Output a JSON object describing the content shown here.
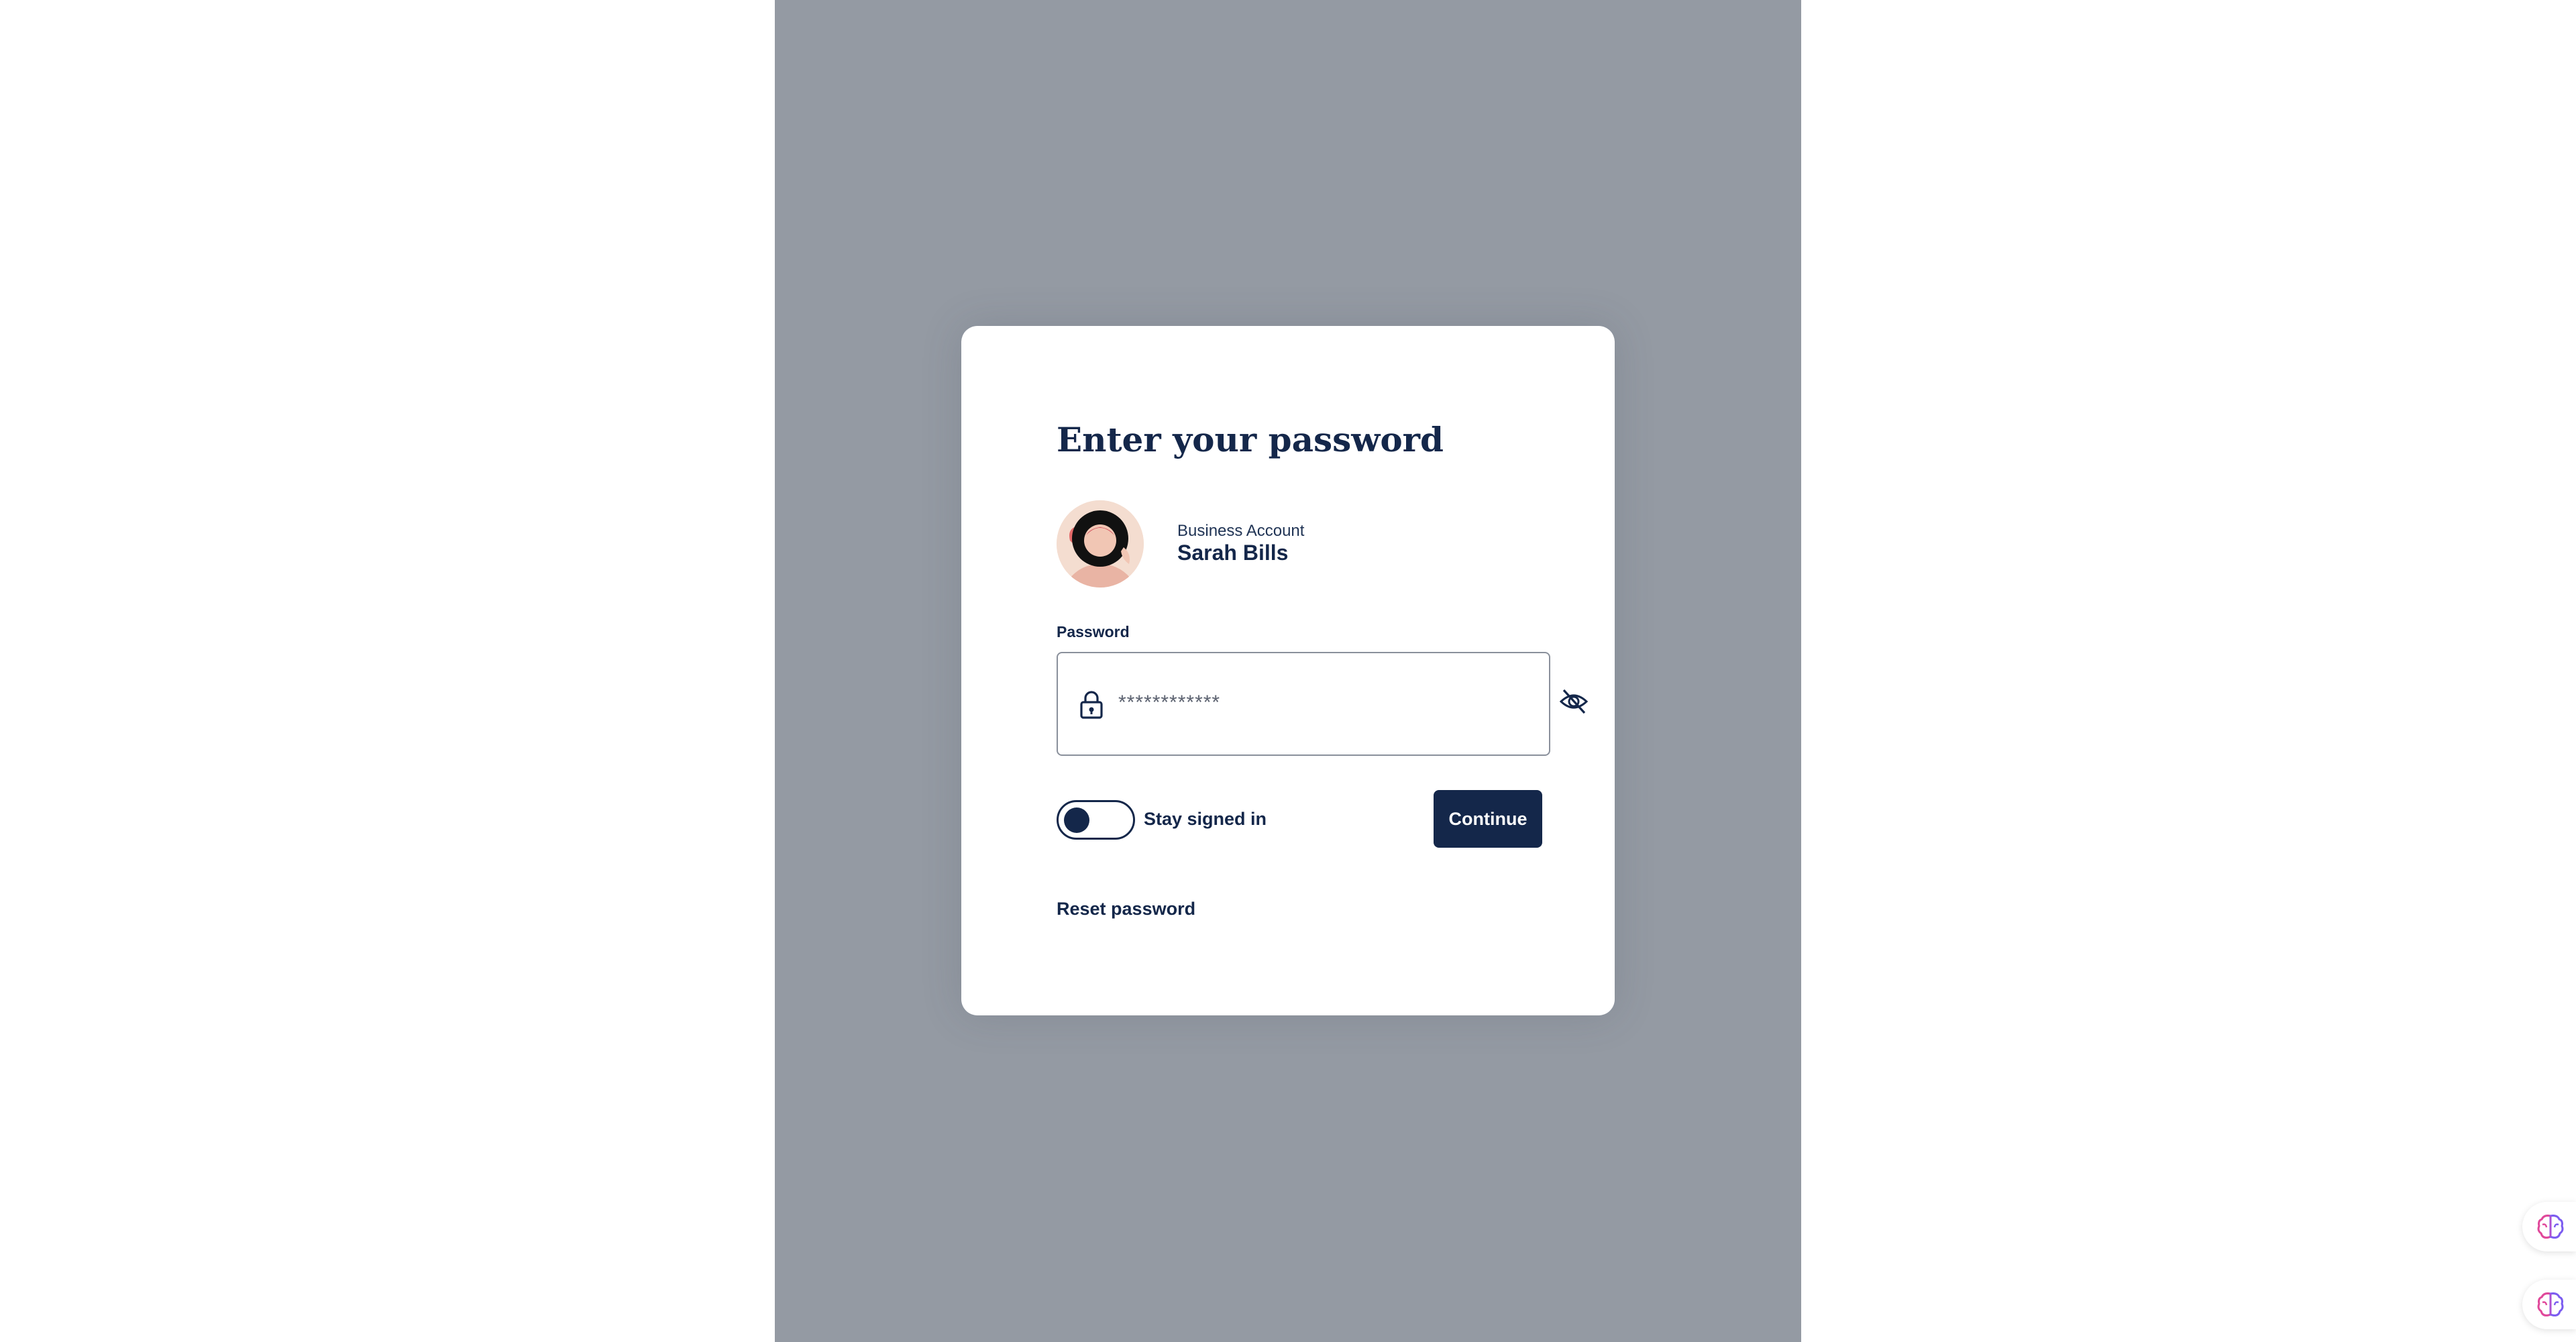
{
  "dialog": {
    "title": "Enter your password",
    "account": {
      "type": "Business Account",
      "name": "Sarah Bills"
    },
    "password": {
      "label": "Password",
      "placeholder": "************",
      "lock_icon": "lock-icon",
      "visibility_icon": "eye-off-icon"
    },
    "stay_signed_in": {
      "label": "Stay signed in",
      "on": false
    },
    "continue_label": "Continue",
    "reset_label": "Reset password"
  },
  "floating_icons": [
    "brain-icon",
    "brain-icon"
  ],
  "colors": {
    "backdrop": "#949aa3",
    "brand_navy": "#14274a",
    "card": "#ffffff",
    "field_border": "#8a909b"
  }
}
